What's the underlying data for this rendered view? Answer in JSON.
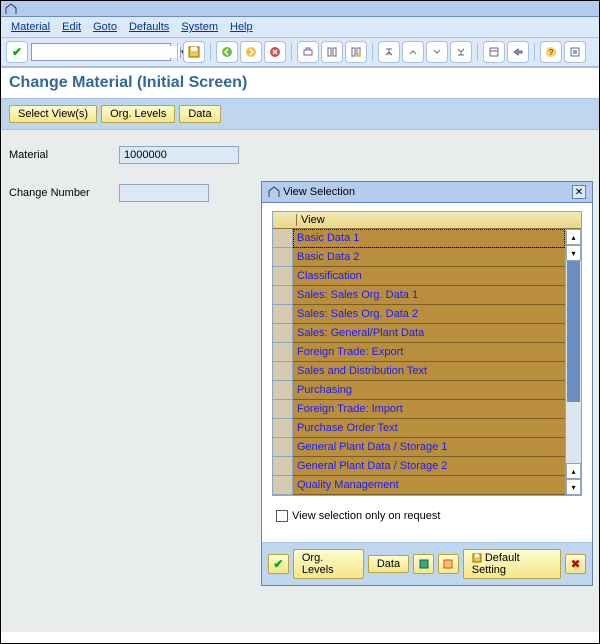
{
  "menubar": {
    "items": [
      "Material",
      "Edit",
      "Goto",
      "Defaults",
      "System",
      "Help"
    ]
  },
  "toolbar1": {
    "combo_value": ""
  },
  "screen": {
    "title": "Change Material (Initial Screen)"
  },
  "apptoolbar": {
    "select_views": "Select View(s)",
    "org_levels": "Org. Levels",
    "data": "Data"
  },
  "form": {
    "material_label": "Material",
    "material_value": "1000000",
    "change_number_label": "Change Number",
    "change_number_value": ""
  },
  "dialog": {
    "title": "View Selection",
    "column_header": "View",
    "views": [
      "Basic Data 1",
      "Basic Data 2",
      "Classification",
      "Sales: Sales Org. Data 1",
      "Sales: Sales Org. Data 2",
      "Sales: General/Plant Data",
      "Foreign Trade: Export",
      "Sales and Distribution Text",
      "Purchasing",
      "Foreign Trade: Import",
      "Purchase Order Text",
      "General Plant Data / Storage 1",
      "General Plant Data / Storage 2",
      "Quality Management"
    ],
    "checkbox_label": "View selection only on request",
    "buttons": {
      "org_levels": "Org. Levels",
      "data": "Data",
      "default_setting": "Default Setting"
    }
  }
}
